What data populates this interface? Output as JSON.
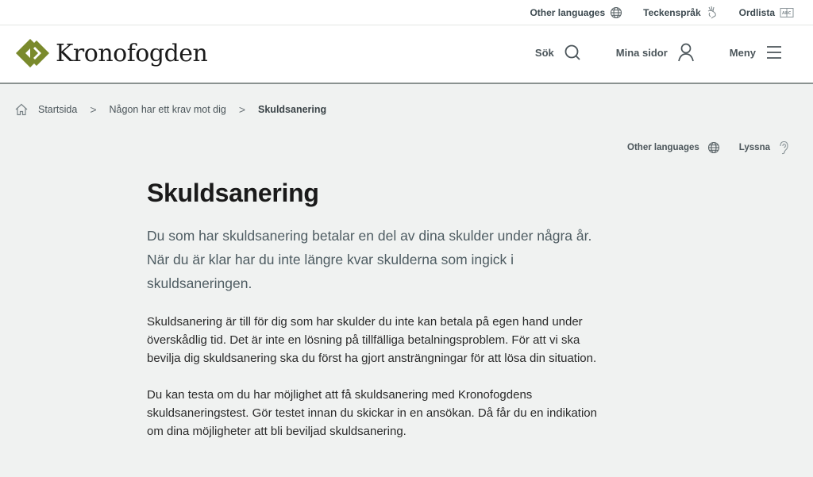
{
  "topbar": {
    "items": [
      {
        "label": "Other languages",
        "icon": "globe-icon"
      },
      {
        "label": "Teckenspråk",
        "icon": "sign-language-icon"
      },
      {
        "label": "Ordlista",
        "icon": "glossary-book-icon"
      }
    ]
  },
  "header": {
    "logo_text": "Kronofogden",
    "brand_color": "#7a8a2c",
    "nav": [
      {
        "label": "Sök",
        "icon": "search-icon"
      },
      {
        "label": "Mina sidor",
        "icon": "user-icon"
      },
      {
        "label": "Meny",
        "icon": "menu-icon"
      }
    ]
  },
  "breadcrumb": {
    "items": [
      "Startsida",
      "Någon har ett krav mot dig",
      "Skuldsanering"
    ]
  },
  "tools": {
    "other_languages": "Other languages",
    "listen": "Lyssna"
  },
  "main": {
    "title": "Skuldsanering",
    "lead": "Du som har skuldsanering betalar en del av dina skulder under några år. När du är klar har du inte längre kvar skulderna som ingick i skuldsaneringen.",
    "paragraphs": [
      "Skuldsanering är till för dig som har skulder du inte kan betala på egen hand under överskådlig tid. Det är inte en lösning på tillfälliga betalningsproblem. För att vi ska bevilja dig skuldsanering ska du först ha gjort ansträngningar för att lösa din situation.",
      "Du kan testa om du har möjlighet att få skuldsanering med Kronofogdens skuldsaneringstest. Gör testet innan du skickar in en ansökan. Då får du en indikation om dina möjligheter att bli beviljad skuldsanering."
    ]
  }
}
